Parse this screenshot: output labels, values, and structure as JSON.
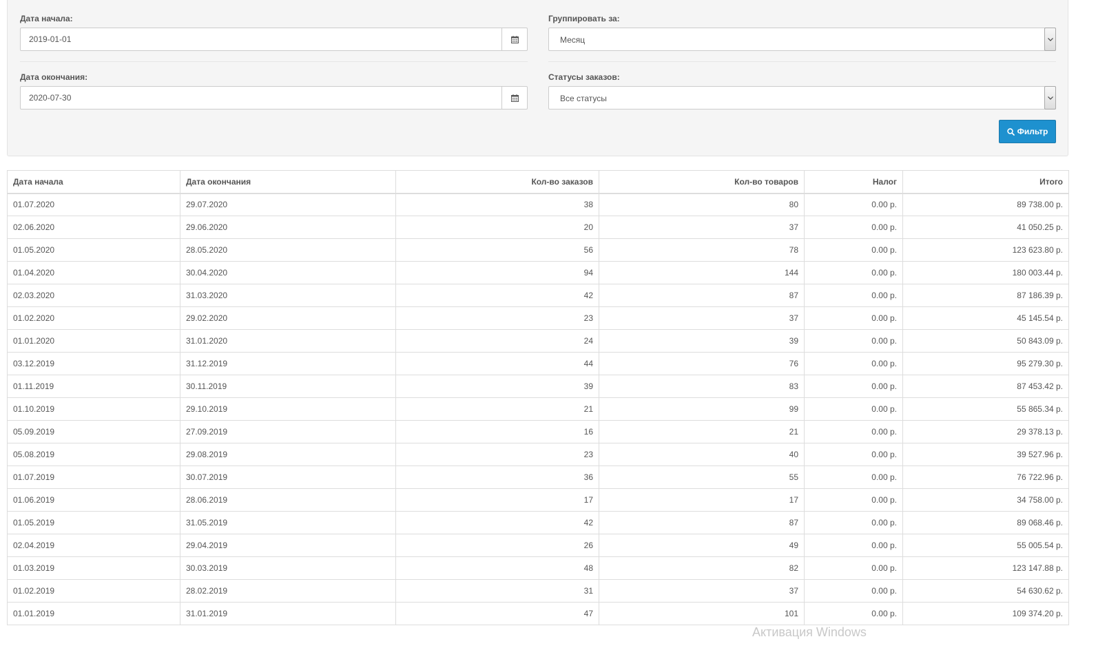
{
  "filters": {
    "start_date": {
      "label": "Дата начала:",
      "value": "2019-01-01"
    },
    "end_date": {
      "label": "Дата окончания:",
      "value": "2020-07-30"
    },
    "group_by": {
      "label": "Группировать за:",
      "value": "Месяц"
    },
    "order_status": {
      "label": "Статусы заказов:",
      "value": "Все статусы"
    },
    "filter_button": "Фильтр"
  },
  "table": {
    "headers": [
      "Дата начала",
      "Дата окончания",
      "Кол-во заказов",
      "Кол-во товаров",
      "Налог",
      "Итого"
    ],
    "rows": [
      [
        "01.07.2020",
        "29.07.2020",
        "38",
        "80",
        "0.00 р.",
        "89 738.00 р."
      ],
      [
        "02.06.2020",
        "29.06.2020",
        "20",
        "37",
        "0.00 р.",
        "41 050.25 р."
      ],
      [
        "01.05.2020",
        "28.05.2020",
        "56",
        "78",
        "0.00 р.",
        "123 623.80 р."
      ],
      [
        "01.04.2020",
        "30.04.2020",
        "94",
        "144",
        "0.00 р.",
        "180 003.44 р."
      ],
      [
        "02.03.2020",
        "31.03.2020",
        "42",
        "87",
        "0.00 р.",
        "87 186.39 р."
      ],
      [
        "01.02.2020",
        "29.02.2020",
        "23",
        "37",
        "0.00 р.",
        "45 145.54 р."
      ],
      [
        "01.01.2020",
        "31.01.2020",
        "24",
        "39",
        "0.00 р.",
        "50 843.09 р."
      ],
      [
        "03.12.2019",
        "31.12.2019",
        "44",
        "76",
        "0.00 р.",
        "95 279.30 р."
      ],
      [
        "01.11.2019",
        "30.11.2019",
        "39",
        "83",
        "0.00 р.",
        "87 453.42 р."
      ],
      [
        "01.10.2019",
        "29.10.2019",
        "21",
        "99",
        "0.00 р.",
        "55 865.34 р."
      ],
      [
        "05.09.2019",
        "27.09.2019",
        "16",
        "21",
        "0.00 р.",
        "29 378.13 р."
      ],
      [
        "05.08.2019",
        "29.08.2019",
        "23",
        "40",
        "0.00 р.",
        "39 527.96 р."
      ],
      [
        "01.07.2019",
        "30.07.2019",
        "36",
        "55",
        "0.00 р.",
        "76 722.96 р."
      ],
      [
        "01.06.2019",
        "28.06.2019",
        "17",
        "17",
        "0.00 р.",
        "34 758.00 р."
      ],
      [
        "01.05.2019",
        "31.05.2019",
        "42",
        "87",
        "0.00 р.",
        "89 068.46 р."
      ],
      [
        "02.04.2019",
        "29.04.2019",
        "26",
        "49",
        "0.00 р.",
        "55 005.54 р."
      ],
      [
        "01.03.2019",
        "30.03.2019",
        "48",
        "82",
        "0.00 р.",
        "123 147.88 р."
      ],
      [
        "01.02.2019",
        "28.02.2019",
        "31",
        "37",
        "0.00 р.",
        "54 630.62 р."
      ],
      [
        "01.01.2019",
        "31.01.2019",
        "47",
        "101",
        "0.00 р.",
        "109 374.20 р."
      ]
    ]
  },
  "watermark": "Активация Windows",
  "icons": {
    "calendar": "calendar-icon",
    "dropdown": "chevron-down-icon",
    "search": "search-icon"
  },
  "colors": {
    "primary_button": "#1e91cf",
    "panel_background": "#f5f5f5"
  }
}
